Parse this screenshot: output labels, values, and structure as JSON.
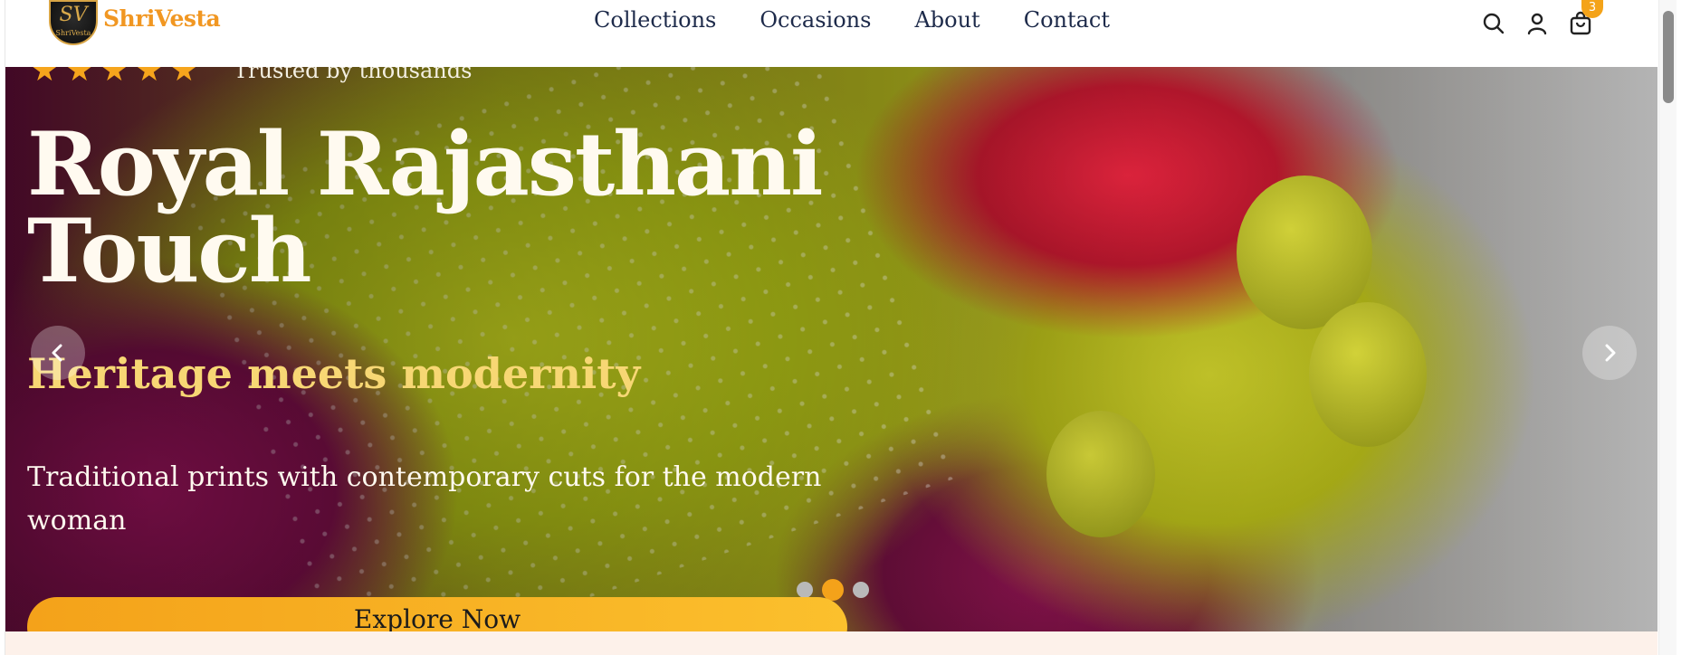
{
  "brand": {
    "name": "ShriVesta",
    "monogram": "SV",
    "logo_text": "ShriVesta"
  },
  "nav": {
    "items": [
      {
        "label": "Collections"
      },
      {
        "label": "Occasions"
      },
      {
        "label": "About"
      },
      {
        "label": "Contact"
      }
    ]
  },
  "header_icons": {
    "search": "search-icon",
    "account": "user-icon",
    "cart": "shopping-bag-icon",
    "cart_count": "3"
  },
  "hero": {
    "rating_stars": 5,
    "trusted_text": "Trusted by thousands",
    "title": "Royal Rajasthani Touch",
    "subtitle": "Heritage meets modernity",
    "description": "Traditional prints with contemporary cuts for the modern woman",
    "cta_label": "Explore Now",
    "slides_total": 3,
    "active_slide": 2
  },
  "colors": {
    "brand_accent": "#f19722",
    "nav_text": "#1d2a4a",
    "star": "#f6a51c",
    "subtitle": "#f7d774",
    "cta": "#f4a21a",
    "active_dot": "#f4a21a",
    "inactive_dot": "#b9b9b9"
  }
}
